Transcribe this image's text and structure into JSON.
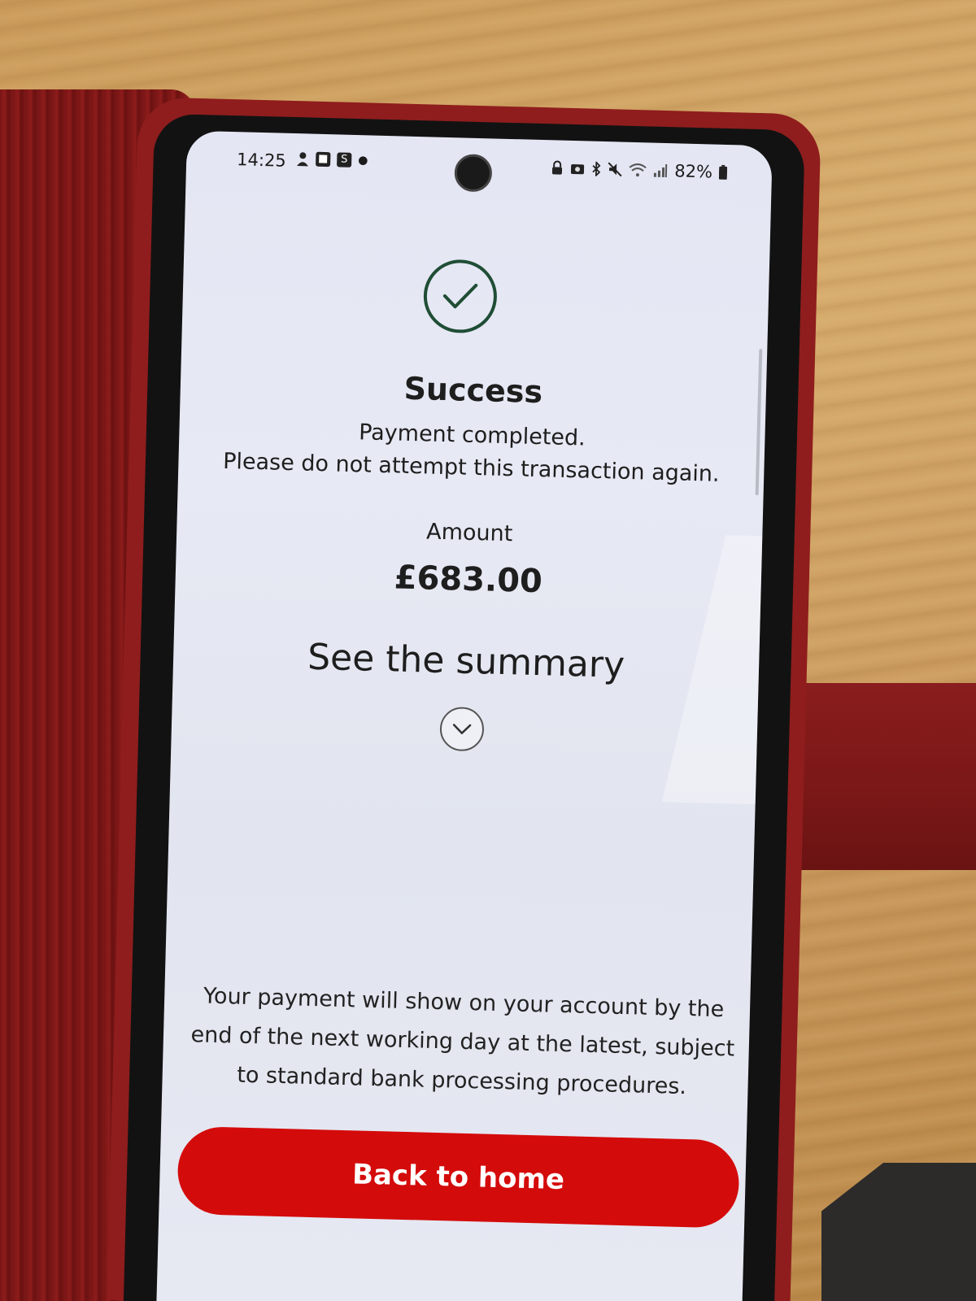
{
  "status_bar": {
    "time": "14:25",
    "left_icons": [
      "person-icon",
      "square-icon",
      "s-app-icon",
      "dot-icon"
    ],
    "s_icon_letter": "S",
    "right_icons": [
      "lock-icon",
      "camera-icon",
      "bluetooth-icon",
      "mute-icon",
      "wifi-icon",
      "signal-icon"
    ],
    "battery": "82%"
  },
  "payment_result": {
    "icon": "check-circle-icon",
    "title": "Success",
    "line1": "Payment completed.",
    "line2": "Please do not attempt this transaction again.",
    "amount_label": "Amount",
    "amount_value": "£683.00"
  },
  "summary": {
    "link_text": "See the summary",
    "toggle_icon": "chevron-down-icon"
  },
  "footer": {
    "info": "Your payment will show on your account by the end of the next working day at the latest, subject to standard bank processing procedures.",
    "button_label": "Back to home"
  },
  "colors": {
    "primary_button": "#d40b0b",
    "success_icon": "#1f4d35",
    "screen_bg": "#e4e6f3",
    "text": "#1e1e1e"
  }
}
